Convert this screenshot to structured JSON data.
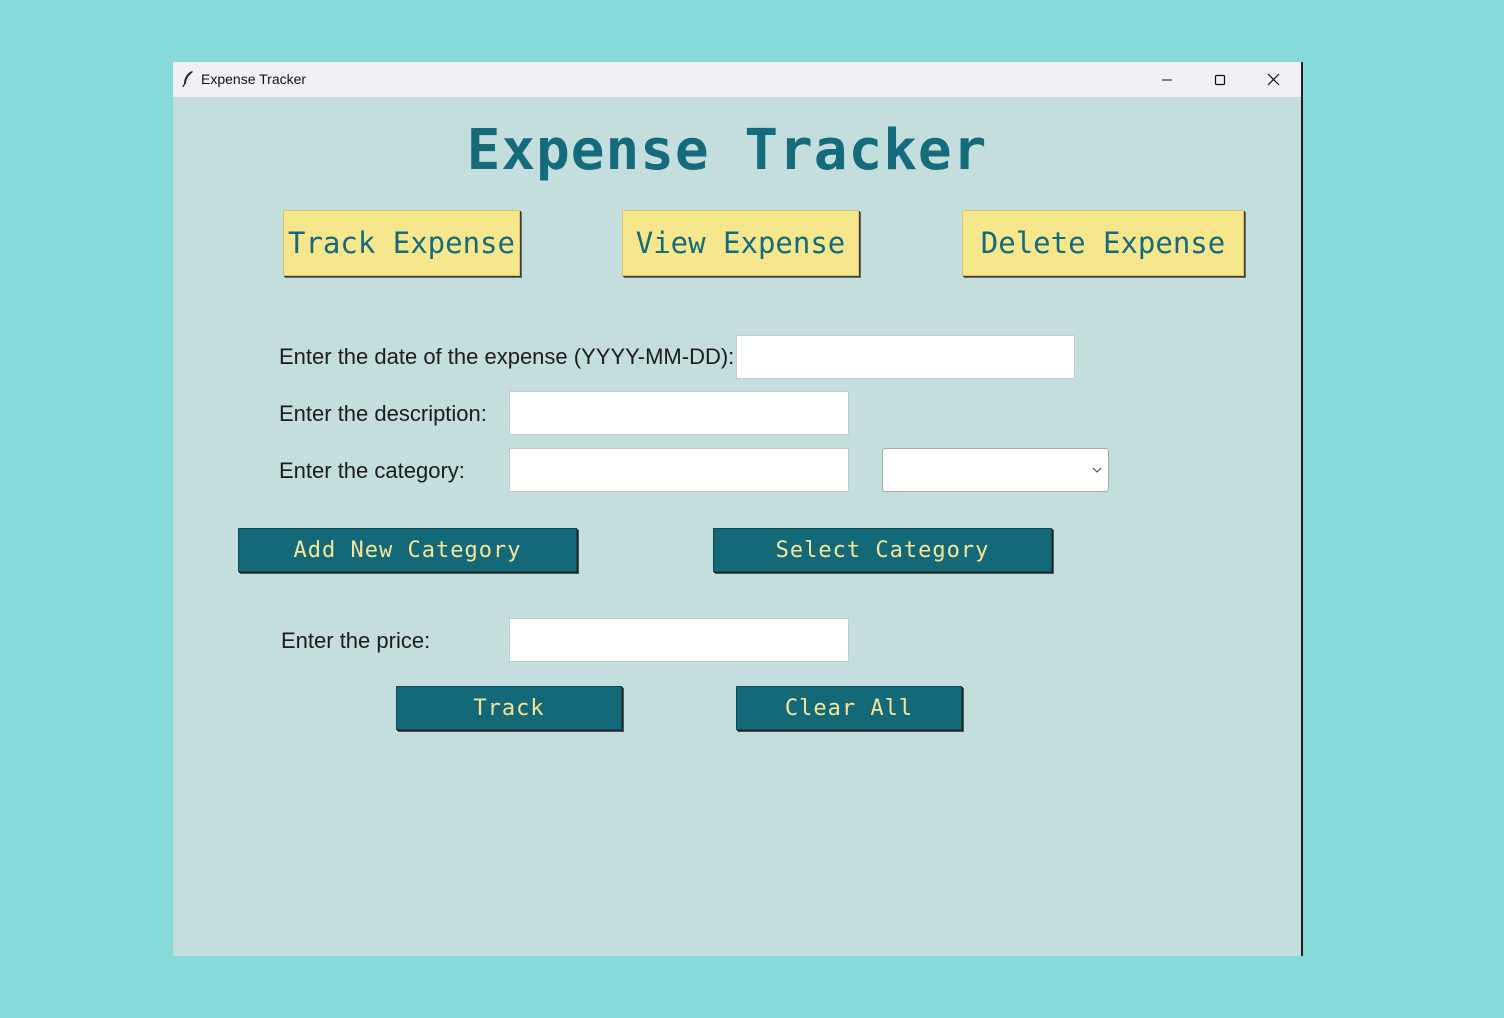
{
  "window": {
    "title": "Expense Tracker",
    "controls": {
      "minimize_icon": "minimize-icon",
      "maximize_icon": "maximize-icon",
      "close_icon": "close-icon"
    }
  },
  "app": {
    "heading": "Expense Tracker",
    "nav": {
      "track": "Track Expense",
      "view": "View Expense",
      "delete": "Delete Expense"
    },
    "form": {
      "date_label": "Enter the date of the expense (YYYY-MM-DD):",
      "date_value": "",
      "description_label": "Enter the description:",
      "description_value": "",
      "category_label": "Enter the category:",
      "category_value": "",
      "category_select_value": "",
      "add_category_button": "Add New Category",
      "select_category_button": "Select Category",
      "price_label": "Enter the price:",
      "price_value": "",
      "track_button": "Track",
      "clear_button": "Clear All"
    }
  },
  "colors": {
    "desktop": "#86dbd9",
    "window_bg": "#c3dedd",
    "accent": "#146978",
    "nav_button_bg": "#f7e78c",
    "button_text": "#f5e59a"
  }
}
